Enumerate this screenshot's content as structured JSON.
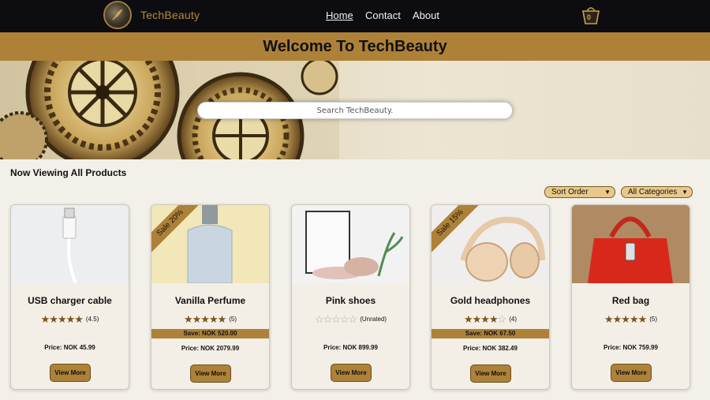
{
  "nav": {
    "brand": "TechBeauty",
    "links": [
      "Home",
      "Contact",
      "About"
    ],
    "cart_count": "0"
  },
  "welcome": "Welcome To TechBeauty",
  "search": {
    "placeholder": "Search TechBeauty."
  },
  "section_title": "Now Viewing All Products",
  "filters": {
    "sort": "Sort Order",
    "category": "All Categories"
  },
  "colors": {
    "accent": "#ad8138",
    "nav_bg": "#0d0c10",
    "page_bg": "#f3f0ea"
  },
  "products": [
    {
      "name": "USB charger cable",
      "rating": 5,
      "rating_text": "(4.5)",
      "price": "Price: NOK 45.99",
      "button": "View More",
      "ribbon": "",
      "save": ""
    },
    {
      "name": "Vanilla Perfume",
      "rating": 5,
      "rating_text": "(5)",
      "price": "Price: NOK 2079.99",
      "button": "View More",
      "ribbon": "Sale 20%",
      "save": "Save: NOK 520.00"
    },
    {
      "name": "Pink shoes",
      "rating": 0,
      "rating_text": "(Unrated)",
      "price": "Price: NOK 899.99",
      "button": "View More",
      "ribbon": "",
      "save": ""
    },
    {
      "name": "Gold headphones",
      "rating": 4,
      "rating_text": "(4)",
      "price": "Price: NOK 382.49",
      "button": "View More",
      "ribbon": "Sale 15%",
      "save": "Save: NOK 67.50"
    },
    {
      "name": "Red bag",
      "rating": 5,
      "rating_text": "(5)",
      "price": "Price: NOK 759.99",
      "button": "View More",
      "ribbon": "",
      "save": ""
    }
  ]
}
